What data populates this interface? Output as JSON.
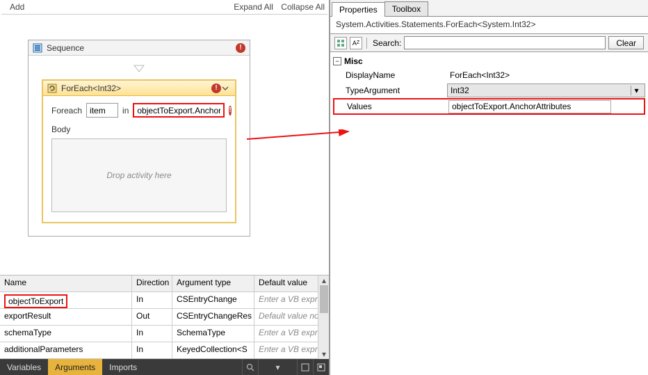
{
  "toolbar": {
    "add": "Add",
    "expand": "Expand All",
    "collapse": "Collapse All"
  },
  "sequence": {
    "title": "Sequence"
  },
  "foreach": {
    "title": "ForEach<Int32>",
    "foreach_label": "Foreach",
    "item_value": "item",
    "in_label": "in",
    "collection_value": "objectToExport.Anchor",
    "body_label": "Body",
    "drop_hint": "Drop activity here"
  },
  "args": {
    "headers": {
      "name": "Name",
      "direction": "Direction",
      "type": "Argument type",
      "default": "Default value"
    },
    "rows": [
      {
        "name": "objectToExport",
        "direction": "In",
        "type": "CSEntryChange",
        "default": "Enter a VB express"
      },
      {
        "name": "exportResult",
        "direction": "Out",
        "type": "CSEntryChangeRes",
        "default": "Default value not su"
      },
      {
        "name": "schemaType",
        "direction": "In",
        "type": "SchemaType",
        "default": "Enter a VB express"
      },
      {
        "name": "additionalParameters",
        "direction": "In",
        "type": "KeyedCollection<S",
        "default": "Enter a VB express"
      }
    ]
  },
  "statusbar": {
    "variables": "Variables",
    "arguments": "Arguments",
    "imports": "Imports"
  },
  "right": {
    "tabs": {
      "properties": "Properties",
      "toolbox": "Toolbox"
    },
    "typeline": "System.Activities.Statements.ForEach<System.Int32>",
    "search_label": "Search:",
    "clear": "Clear",
    "category": "Misc",
    "rows": {
      "displayName": {
        "name": "DisplayName",
        "value": "ForEach<Int32>"
      },
      "typeArgument": {
        "name": "TypeArgument",
        "value": "Int32"
      },
      "values": {
        "name": "Values",
        "value": "objectToExport.AnchorAttributes"
      }
    }
  }
}
